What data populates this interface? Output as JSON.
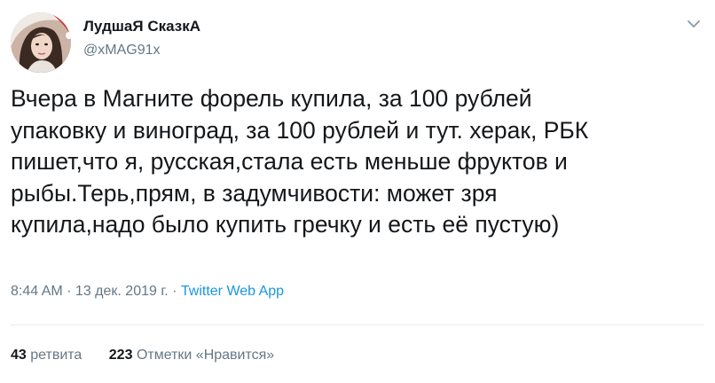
{
  "author": {
    "display_name": "ЛудшаЯ СказкА",
    "username": "@xMAG91x",
    "avatar": "user-avatar"
  },
  "tweet": {
    "text": "Вчера в Магните форель купила, за 100 рублей\nупаковку и виноград, за 100 рублей и тут. херак, РБК\nпишет,что я, русская,стала есть меньше фруктов и\nрыбы.Терь,прям, в задумчивости: может зря\nкупила,надо было купить гречку и есть её пустую)"
  },
  "meta": {
    "time": "8:44 AM",
    "separator": " · ",
    "date": "13 дек. 2019 г.",
    "app": "Twitter Web App"
  },
  "stats": {
    "retweets_count": "43",
    "retweets_label": "ретвита",
    "likes_count": "223",
    "likes_label": "Отметки «Нравится»"
  },
  "icons": {
    "menu": "chevron-down-icon"
  },
  "colors": {
    "text": "#14171a",
    "secondary": "#657786",
    "link": "#1b95e0",
    "divider": "#e6ecf0"
  }
}
